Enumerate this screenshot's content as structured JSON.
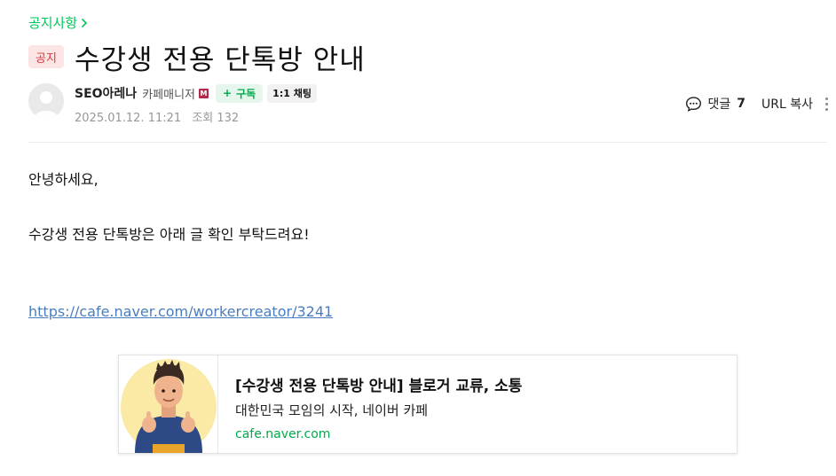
{
  "breadcrumb": {
    "label": "공지사항"
  },
  "article": {
    "badge": "공지",
    "title": "수강생 전용 단톡방 안내"
  },
  "author": {
    "name": "SEO아레나",
    "role": "카페매니저",
    "role_mark": "M",
    "follow_label": "구독",
    "chat_label": "1:1 채팅",
    "date": "2025.01.12. 11:21",
    "views_label": "조회",
    "views": "132"
  },
  "actions": {
    "comment_label": "댓글",
    "comment_count": "7",
    "url_copy_label": "URL 복사"
  },
  "content": {
    "greeting": "안녕하세요,",
    "body": "수강생 전용 단톡방은 아래 글 확인 부탁드려요!",
    "link_text": "https://cafe.naver.com/workercreator/3241"
  },
  "og_card": {
    "title": "[수강생 전용 단톡방 안내] 블로거 교류, 소통",
    "description": "대한민국 모임의 시작, 네이버 카페",
    "url": "cafe.naver.com"
  },
  "colors": {
    "accent_green": "#03c75a",
    "notice_red": "#e03838",
    "link_blue": "#4a7dc0",
    "manager_mark": "#b02a4b"
  },
  "icons": {
    "breadcrumb_arrow": "chevron-right-icon",
    "comment": "comment-bubble-icon",
    "more": "more-vertical-icon",
    "avatar": "default-avatar-icon"
  }
}
